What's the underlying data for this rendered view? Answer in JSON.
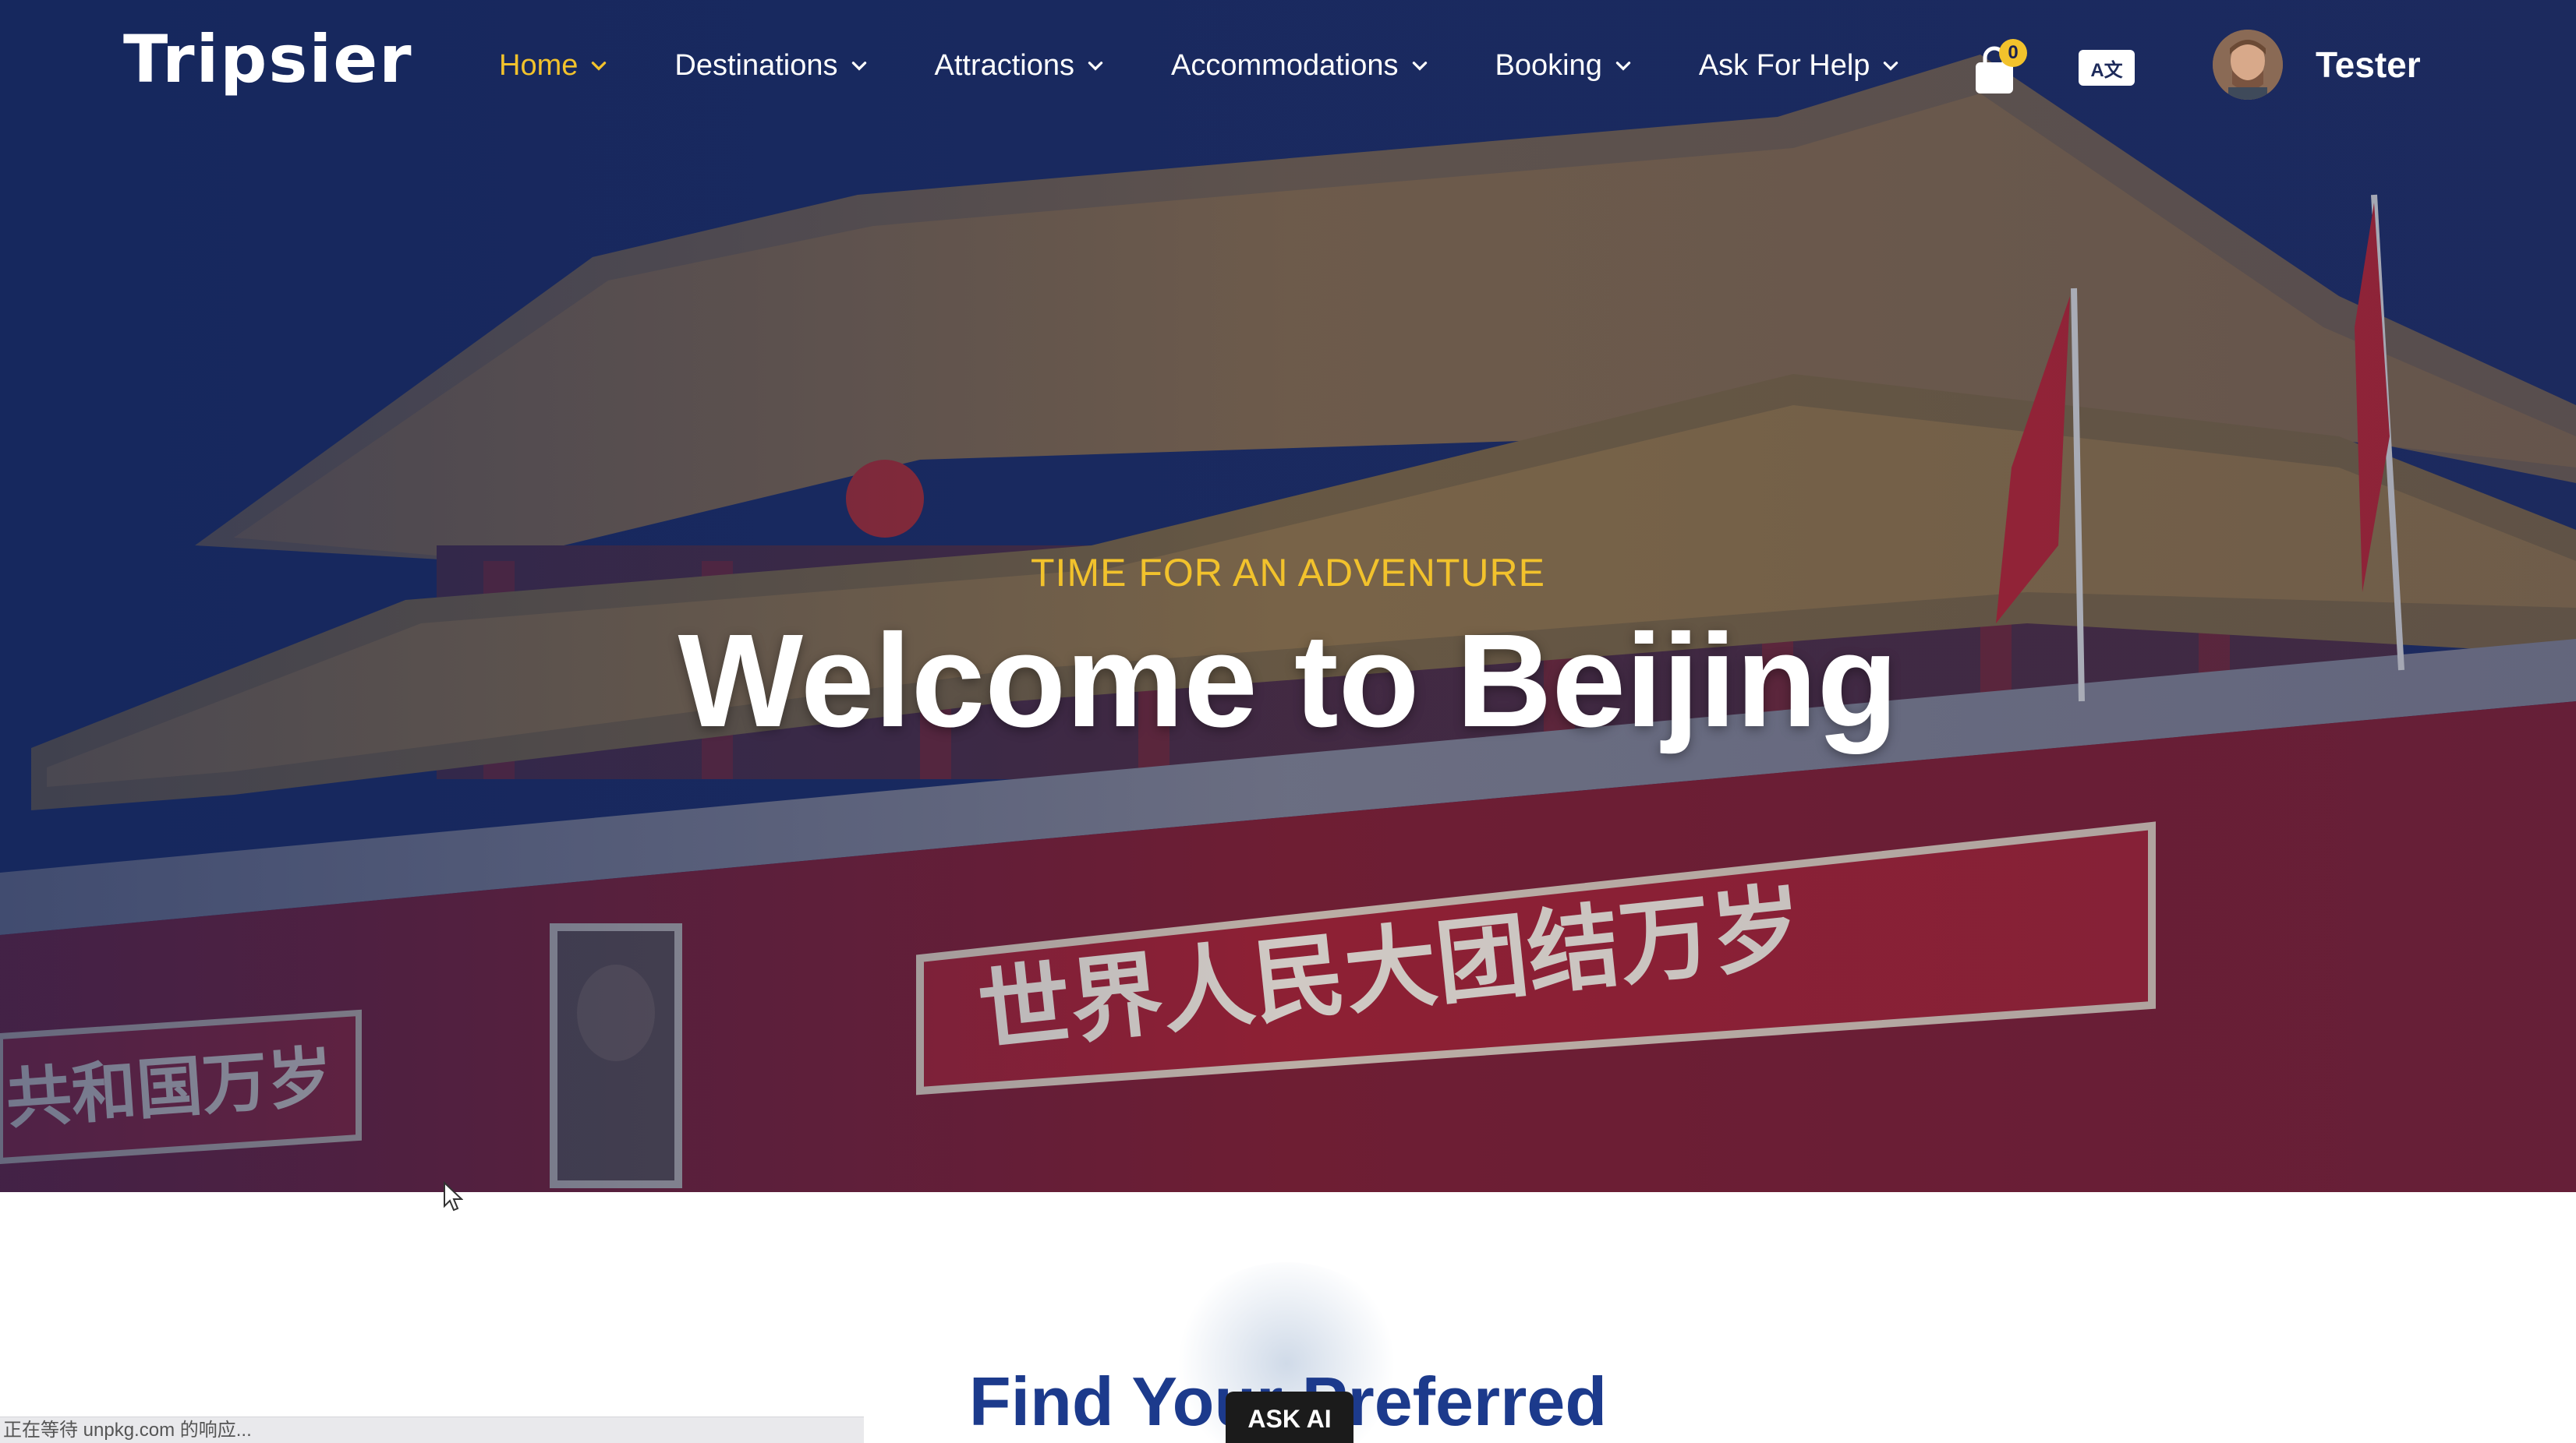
{
  "header": {
    "logo_text": "Tripsier",
    "nav": [
      {
        "label": "Home",
        "active": true
      },
      {
        "label": "Destinations",
        "active": false
      },
      {
        "label": "Attractions",
        "active": false
      },
      {
        "label": "Accommodations",
        "active": false
      },
      {
        "label": "Booking",
        "active": false
      },
      {
        "label": "Ask For Help",
        "active": false
      }
    ],
    "cart_count": "0",
    "translate_icon": "A文",
    "username": "Tester"
  },
  "hero": {
    "tagline": "TIME FOR AN ADVENTURE",
    "title": "Welcome to Beijing",
    "banner_text": "世界人民大团结万岁",
    "side_banner_text": "共和国万岁"
  },
  "main": {
    "section_title": "Find Your Preferred"
  },
  "ask_ai_label": "ASK AI",
  "status_bar": "正在等待 unpkg.com 的响应...",
  "colors": {
    "accent": "#f2c22c",
    "title_blue": "#1c3a8c",
    "gate_red": "#8c1f24"
  }
}
